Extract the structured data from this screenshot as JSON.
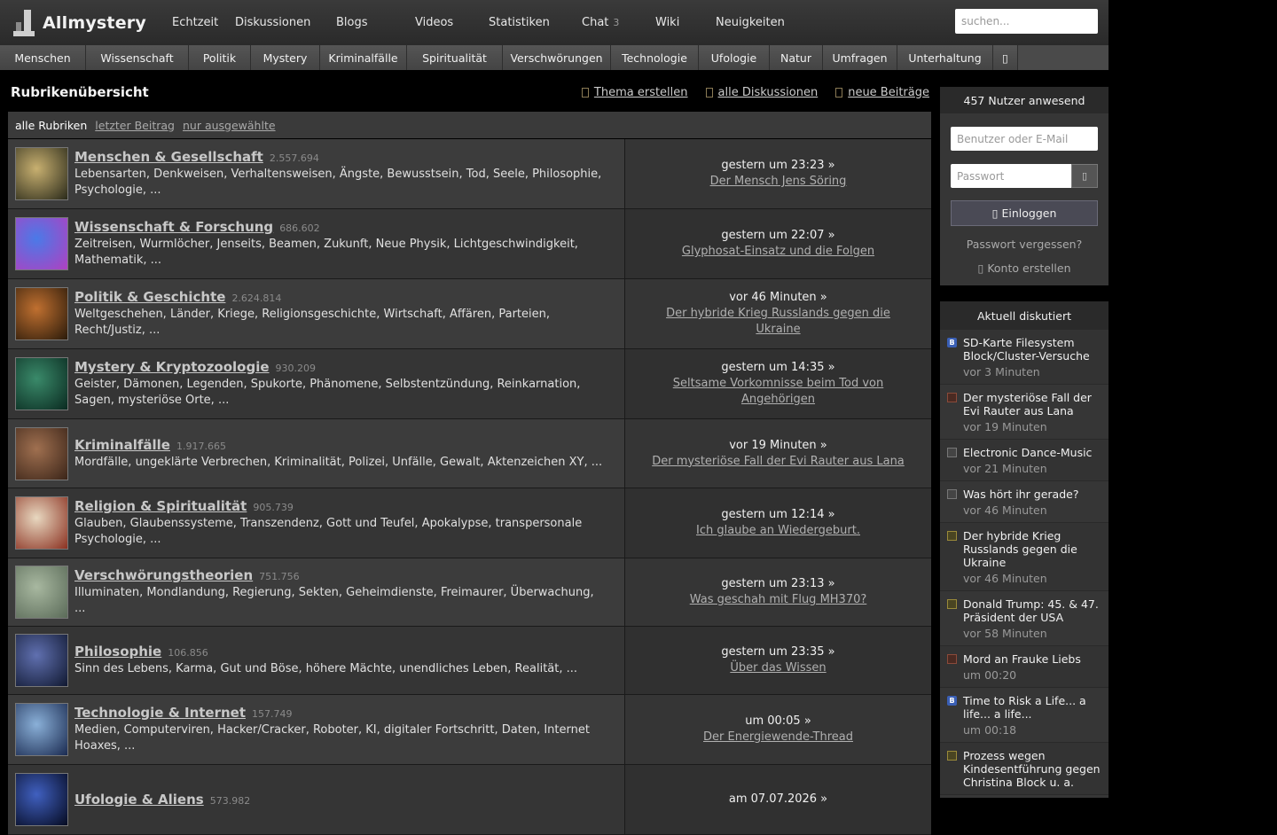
{
  "brand": "Allmystery",
  "nav": [
    {
      "label": "Echtzeit",
      "badge": ""
    },
    {
      "label": "Diskussionen",
      "badge": ""
    },
    {
      "label": "Blogs",
      "badge": ""
    },
    {
      "label": "Videos",
      "badge": ""
    },
    {
      "label": "Statistiken",
      "badge": ""
    },
    {
      "label": "Chat",
      "badge": "3"
    },
    {
      "label": "Wiki",
      "badge": ""
    },
    {
      "label": "Neuigkeiten",
      "badge": ""
    }
  ],
  "search": {
    "placeholder": "suchen..."
  },
  "categories": [
    "Menschen",
    "Wissenschaft",
    "Politik",
    "Mystery",
    "Kriminalfälle",
    "Spiritualität",
    "Verschwörungen",
    "Technologie",
    "Ufologie",
    "Natur",
    "Umfragen",
    "Unterhaltung",
    "▯"
  ],
  "page": {
    "title": "Rubrikenübersicht",
    "actions": [
      "Thema erstellen",
      "alle Diskussionen",
      "neue Beiträge"
    ]
  },
  "filters": {
    "active": "alle Rubriken",
    "links": [
      "letzter Beitrag",
      "nur ausgewählte"
    ]
  },
  "rubrics": [
    {
      "name": "Menschen & Gesellschaft",
      "count": "2.557.694",
      "desc": "Lebensarten, Denkweisen, Verhaltensweisen, Ängste, Bewusstsein, Tod, Seele, Philosophie, Psychologie, ...",
      "time": "gestern um 23:23 »",
      "topic": "Der Mensch Jens Söring",
      "color1": "#c8b070",
      "color2": "#2a2a1a"
    },
    {
      "name": "Wissenschaft & Forschung",
      "count": "686.602",
      "desc": "Zeitreisen, Wurmlöcher, Jenseits, Beamen, Zukunft, Neue Physik, Lichtgeschwindigkeit, Mathematik, ...",
      "time": "gestern um 22:07 »",
      "topic": "Glyphosat-Einsatz und die Folgen",
      "color1": "#4a7ae8",
      "color2": "#b040c0"
    },
    {
      "name": "Politik & Geschichte",
      "count": "2.624.814",
      "desc": "Weltgeschehen, Länder, Kriege, Religionsgeschichte, Wirtschaft, Affären, Parteien, Recht/Justiz, ...",
      "time": "vor 46 Minuten »",
      "topic": "Der hybride Krieg Russlands gegen die Ukraine",
      "color1": "#c07030",
      "color2": "#2a1a0a"
    },
    {
      "name": "Mystery & Kryptozoologie",
      "count": "930.209",
      "desc": "Geister, Dämonen, Legenden, Spukorte, Phänomene, Selbstentzündung, Reinkarnation, Sagen, mysteriöse Orte, ...",
      "time": "gestern um 14:35 »",
      "topic": "Seltsame Vorkomnisse beim Tod von Angehörigen",
      "color1": "#3a8a6a",
      "color2": "#0a2a20"
    },
    {
      "name": "Kriminalfälle",
      "count": "1.917.665",
      "desc": "Mordfälle, ungeklärte Verbrechen, Kriminalität, Polizei, Unfälle, Gewalt, Aktenzeichen XY, ...",
      "time": "vor 19 Minuten »",
      "topic": "Der mysteriöse Fall der Evi Rauter aus Lana",
      "color1": "#a07050",
      "color2": "#3a2418"
    },
    {
      "name": "Religion & Spiritualität",
      "count": "905.739",
      "desc": "Glauben, Glaubenssysteme, Transzendenz, Gott und Teufel, Apokalypse, transpersonale Psychologie, ...",
      "time": "gestern um 12:14 »",
      "topic": "Ich glaube an Wiedergeburt.",
      "color1": "#e8d8c0",
      "color2": "#8a3020"
    },
    {
      "name": "Verschwörungstheorien",
      "count": "751.756",
      "desc": "Illuminaten, Mondlandung, Regierung, Sekten, Geheimdienste, Freimaurer, Überwachung, ...",
      "time": "gestern um 23:13 »",
      "topic": "Was geschah mit Flug MH370?",
      "color1": "#a8b8a0",
      "color2": "#5a6a58"
    },
    {
      "name": "Philosophie",
      "count": "106.856",
      "desc": "Sinn des Lebens, Karma, Gut und Böse, höhere Mächte, unendliches Leben, Realität, ...",
      "time": "gestern um 23:35 »",
      "topic": "Über das Wissen",
      "color1": "#6070b0",
      "color2": "#101830"
    },
    {
      "name": "Technologie & Internet",
      "count": "157.749",
      "desc": "Medien, Computerviren, Hacker/Cracker, Roboter, KI, digitaler Fortschritt, Daten, Internet Hoaxes, ...",
      "time": "um 00:05 »",
      "topic": "Der Energiewende-Thread",
      "color1": "#8ab0d8",
      "color2": "#1a2a50"
    },
    {
      "name": "Ufologie & Aliens",
      "count": "573.982",
      "desc": "",
      "time": "am 07.07.2026 »",
      "topic": "",
      "color1": "#4060c0",
      "color2": "#050a20"
    }
  ],
  "login": {
    "online": "457 Nutzer anwesend",
    "user_placeholder": "Benutzer oder E-Mail",
    "pass_placeholder": "Passwort",
    "eye": "▯",
    "login_label": "▯  Einloggen",
    "forgot": "Passwort vergessen?",
    "register": "▯  Konto erstellen"
  },
  "discussed": {
    "title": "Aktuell diskutiert",
    "items": [
      {
        "icon": "blog",
        "glyph": "B",
        "title": "SD-Karte Filesystem Block/Cluster-Versuche",
        "time": "vor 3 Minuten"
      },
      {
        "icon": "red",
        "glyph": "",
        "title": "Der mysteriöse Fall der Evi Rauter aus Lana",
        "time": "vor 19 Minuten"
      },
      {
        "icon": "grey",
        "glyph": "",
        "title": "Electronic Dance-Music",
        "time": "vor 21 Minuten"
      },
      {
        "icon": "grey",
        "glyph": "",
        "title": "Was hört ihr gerade?",
        "time": "vor 46 Minuten"
      },
      {
        "icon": "yellow",
        "glyph": "",
        "title": "Der hybride Krieg Russlands gegen die Ukraine",
        "time": "vor 46 Minuten"
      },
      {
        "icon": "yellow",
        "glyph": "",
        "title": "Donald Trump: 45. & 47. Präsident der USA",
        "time": "vor 58 Minuten"
      },
      {
        "icon": "red",
        "glyph": "",
        "title": "Mord an Frauke Liebs",
        "time": "um 00:20"
      },
      {
        "icon": "blog",
        "glyph": "B",
        "title": "Time to Risk a Life... a life... a life...",
        "time": "um 00:18"
      },
      {
        "icon": "yellow",
        "glyph": "",
        "title": "Prozess wegen Kindesentführung gegen Christina Block u. a.",
        "time": ""
      }
    ]
  }
}
